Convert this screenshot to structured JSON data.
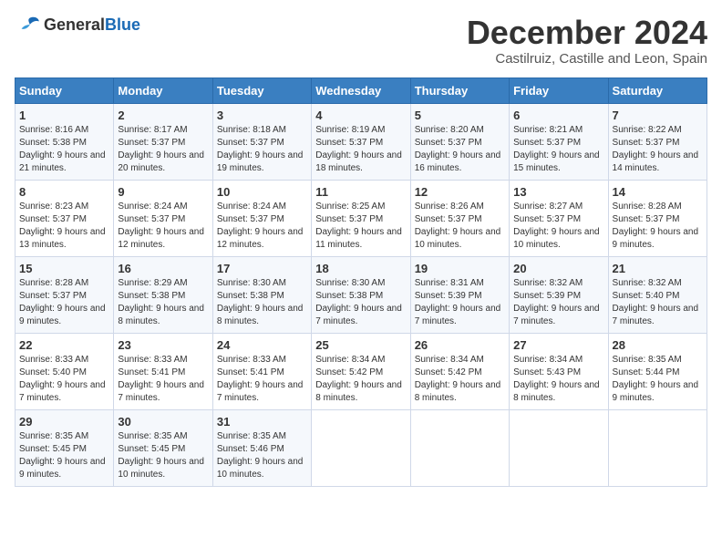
{
  "logo": {
    "general": "General",
    "blue": "Blue"
  },
  "title": "December 2024",
  "location": "Castilruiz, Castille and Leon, Spain",
  "days_of_week": [
    "Sunday",
    "Monday",
    "Tuesday",
    "Wednesday",
    "Thursday",
    "Friday",
    "Saturday"
  ],
  "weeks": [
    [
      {
        "day": "1",
        "sunrise": "8:16 AM",
        "sunset": "5:38 PM",
        "daylight": "9 hours and 21 minutes."
      },
      {
        "day": "2",
        "sunrise": "8:17 AM",
        "sunset": "5:37 PM",
        "daylight": "9 hours and 20 minutes."
      },
      {
        "day": "3",
        "sunrise": "8:18 AM",
        "sunset": "5:37 PM",
        "daylight": "9 hours and 19 minutes."
      },
      {
        "day": "4",
        "sunrise": "8:19 AM",
        "sunset": "5:37 PM",
        "daylight": "9 hours and 18 minutes."
      },
      {
        "day": "5",
        "sunrise": "8:20 AM",
        "sunset": "5:37 PM",
        "daylight": "9 hours and 16 minutes."
      },
      {
        "day": "6",
        "sunrise": "8:21 AM",
        "sunset": "5:37 PM",
        "daylight": "9 hours and 15 minutes."
      },
      {
        "day": "7",
        "sunrise": "8:22 AM",
        "sunset": "5:37 PM",
        "daylight": "9 hours and 14 minutes."
      }
    ],
    [
      {
        "day": "8",
        "sunrise": "8:23 AM",
        "sunset": "5:37 PM",
        "daylight": "9 hours and 13 minutes."
      },
      {
        "day": "9",
        "sunrise": "8:24 AM",
        "sunset": "5:37 PM",
        "daylight": "9 hours and 12 minutes."
      },
      {
        "day": "10",
        "sunrise": "8:24 AM",
        "sunset": "5:37 PM",
        "daylight": "9 hours and 12 minutes."
      },
      {
        "day": "11",
        "sunrise": "8:25 AM",
        "sunset": "5:37 PM",
        "daylight": "9 hours and 11 minutes."
      },
      {
        "day": "12",
        "sunrise": "8:26 AM",
        "sunset": "5:37 PM",
        "daylight": "9 hours and 10 minutes."
      },
      {
        "day": "13",
        "sunrise": "8:27 AM",
        "sunset": "5:37 PM",
        "daylight": "9 hours and 10 minutes."
      },
      {
        "day": "14",
        "sunrise": "8:28 AM",
        "sunset": "5:37 PM",
        "daylight": "9 hours and 9 minutes."
      }
    ],
    [
      {
        "day": "15",
        "sunrise": "8:28 AM",
        "sunset": "5:37 PM",
        "daylight": "9 hours and 9 minutes."
      },
      {
        "day": "16",
        "sunrise": "8:29 AM",
        "sunset": "5:38 PM",
        "daylight": "9 hours and 8 minutes."
      },
      {
        "day": "17",
        "sunrise": "8:30 AM",
        "sunset": "5:38 PM",
        "daylight": "9 hours and 8 minutes."
      },
      {
        "day": "18",
        "sunrise": "8:30 AM",
        "sunset": "5:38 PM",
        "daylight": "9 hours and 7 minutes."
      },
      {
        "day": "19",
        "sunrise": "8:31 AM",
        "sunset": "5:39 PM",
        "daylight": "9 hours and 7 minutes."
      },
      {
        "day": "20",
        "sunrise": "8:32 AM",
        "sunset": "5:39 PM",
        "daylight": "9 hours and 7 minutes."
      },
      {
        "day": "21",
        "sunrise": "8:32 AM",
        "sunset": "5:40 PM",
        "daylight": "9 hours and 7 minutes."
      }
    ],
    [
      {
        "day": "22",
        "sunrise": "8:33 AM",
        "sunset": "5:40 PM",
        "daylight": "9 hours and 7 minutes."
      },
      {
        "day": "23",
        "sunrise": "8:33 AM",
        "sunset": "5:41 PM",
        "daylight": "9 hours and 7 minutes."
      },
      {
        "day": "24",
        "sunrise": "8:33 AM",
        "sunset": "5:41 PM",
        "daylight": "9 hours and 7 minutes."
      },
      {
        "day": "25",
        "sunrise": "8:34 AM",
        "sunset": "5:42 PM",
        "daylight": "9 hours and 8 minutes."
      },
      {
        "day": "26",
        "sunrise": "8:34 AM",
        "sunset": "5:42 PM",
        "daylight": "9 hours and 8 minutes."
      },
      {
        "day": "27",
        "sunrise": "8:34 AM",
        "sunset": "5:43 PM",
        "daylight": "9 hours and 8 minutes."
      },
      {
        "day": "28",
        "sunrise": "8:35 AM",
        "sunset": "5:44 PM",
        "daylight": "9 hours and 9 minutes."
      }
    ],
    [
      {
        "day": "29",
        "sunrise": "8:35 AM",
        "sunset": "5:45 PM",
        "daylight": "9 hours and 9 minutes."
      },
      {
        "day": "30",
        "sunrise": "8:35 AM",
        "sunset": "5:45 PM",
        "daylight": "9 hours and 10 minutes."
      },
      {
        "day": "31",
        "sunrise": "8:35 AM",
        "sunset": "5:46 PM",
        "daylight": "9 hours and 10 minutes."
      },
      null,
      null,
      null,
      null
    ]
  ],
  "labels": {
    "sunrise": "Sunrise:",
    "sunset": "Sunset:",
    "daylight": "Daylight:"
  }
}
